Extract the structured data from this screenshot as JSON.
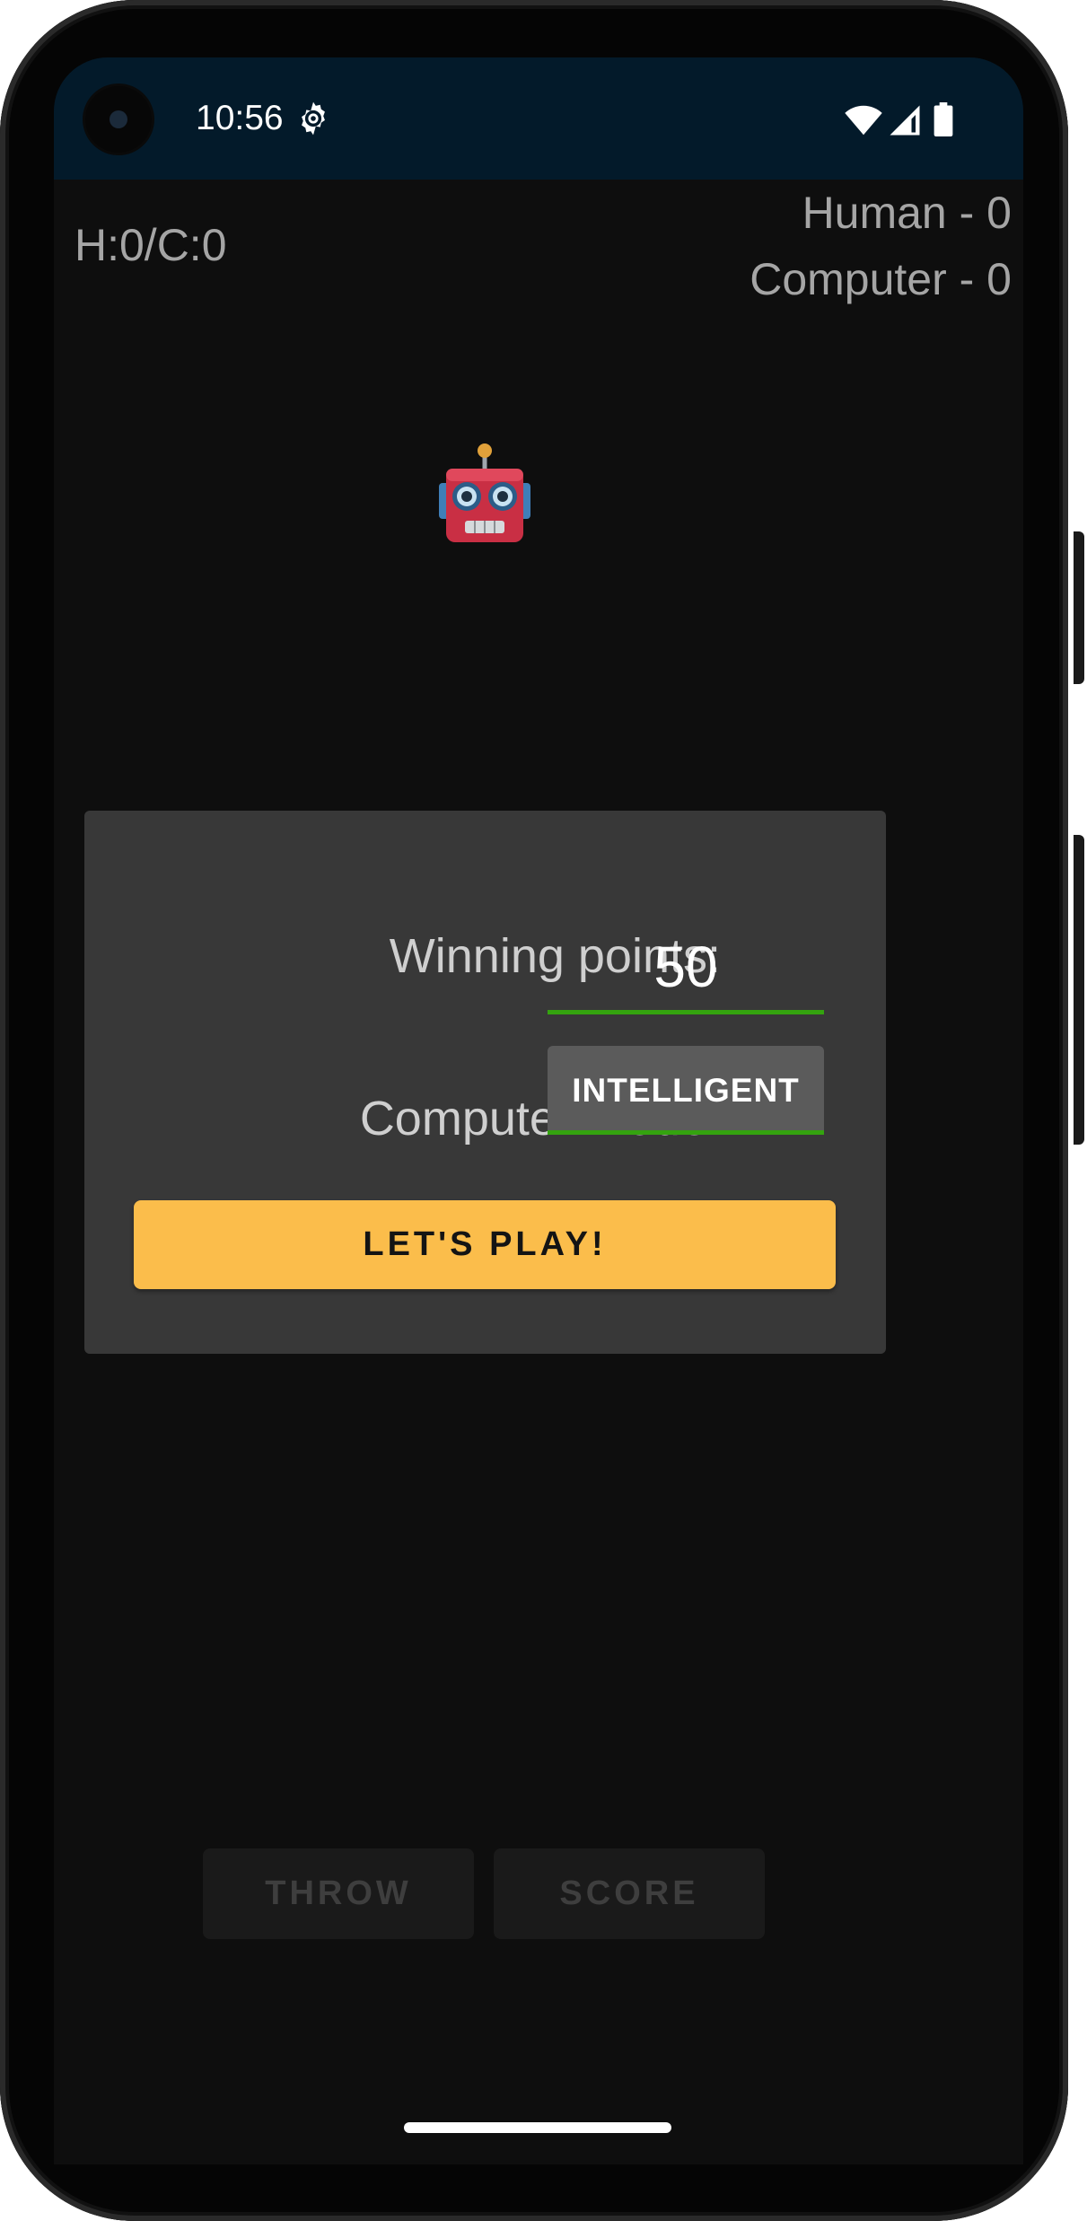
{
  "status_bar": {
    "time": "10:56",
    "icons": [
      "settings-gear-icon",
      "wifi-icon",
      "cell-signal-icon",
      "battery-icon"
    ]
  },
  "scoreboard": {
    "summary": "H:0/C:0",
    "human": "Human - 0",
    "computer": "Computer - 0"
  },
  "opponent_avatar": "robot-icon",
  "setup_dialog": {
    "winning_points_label": "Winning points:",
    "winning_points_value": "50",
    "computer_mode_label": "Computer mode:",
    "computer_mode_value": "INTELLIGENT",
    "play_label": "LET'S PLAY!"
  },
  "actions": {
    "throw_label": "THROW",
    "score_label": "SCORE"
  },
  "colors": {
    "accent_yellow": "#fbbd4b",
    "underline_green": "#34a30f",
    "background": "#0e0e0e",
    "dialog": "#383838",
    "status_bar": "#031a2a"
  }
}
